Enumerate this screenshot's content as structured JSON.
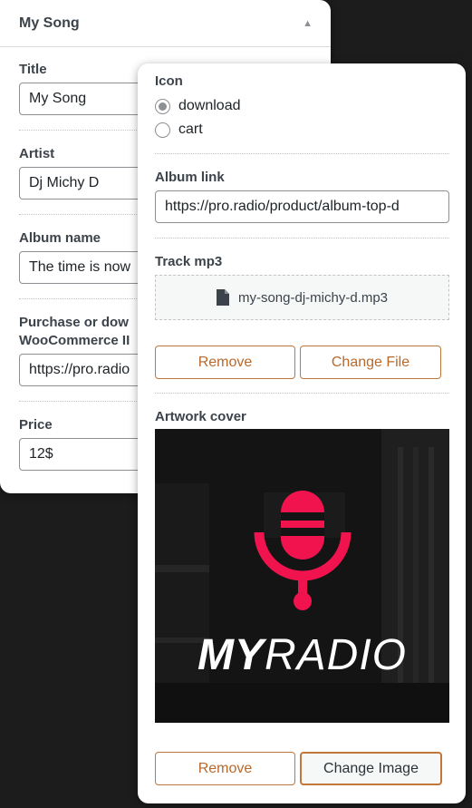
{
  "back_panel": {
    "title": "My Song",
    "collapse_icon": "triangle-up-icon",
    "fields": {
      "title": {
        "label": "Title",
        "value": "My Song"
      },
      "artist": {
        "label": "Artist",
        "value": "Dj Michy D"
      },
      "album_name": {
        "label": "Album name",
        "value": "The time is now"
      },
      "purchase": {
        "label_line1": "Purchase or dow",
        "label_line2": "WooCommerce II",
        "value": "https://pro.radio"
      },
      "price": {
        "label": "Price",
        "value": "12$"
      }
    }
  },
  "front_panel": {
    "icon": {
      "label": "Icon",
      "options": [
        {
          "label": "download",
          "selected": true
        },
        {
          "label": "cart",
          "selected": false
        }
      ]
    },
    "album_link": {
      "label": "Album link",
      "value": "https://pro.radio/product/album-top-d"
    },
    "track_mp3": {
      "label": "Track mp3",
      "file_icon": "file-icon",
      "file_name": "my-song-dj-michy-d.mp3",
      "remove_label": "Remove",
      "change_label": "Change File"
    },
    "artwork": {
      "label": "Artwork cover",
      "logo_text_bold": "MY",
      "logo_text_light": "RADIO",
      "logo_icon": "microphone-icon",
      "accent_color": "#f0134d",
      "remove_label": "Remove",
      "change_label": "Change Image"
    }
  }
}
